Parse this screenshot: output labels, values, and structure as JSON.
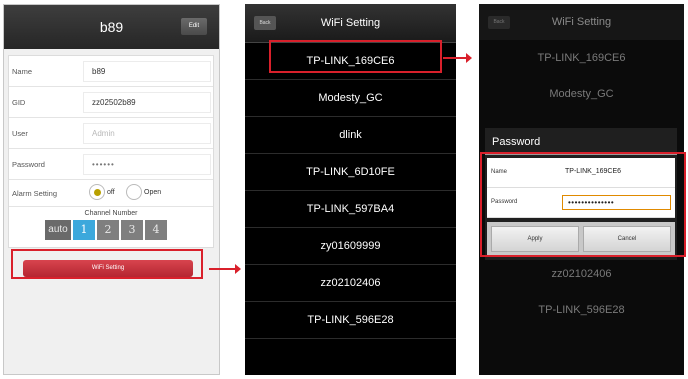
{
  "panel1": {
    "title": "b89",
    "edit_label": "Edit",
    "fields": [
      {
        "label": "Name",
        "value": "b89",
        "placeholder": false
      },
      {
        "label": "GID",
        "value": "zz02502b89",
        "placeholder": false
      },
      {
        "label": "User",
        "value": "Admin",
        "placeholder": true
      },
      {
        "label": "Password",
        "value": "••••••",
        "placeholder": false
      }
    ],
    "alarm": {
      "label": "Alarm Setting",
      "off_label": "off",
      "open_label": "Open",
      "selected": "off"
    },
    "channel": {
      "title": "Channel Number",
      "options": [
        "auto",
        "1",
        "2",
        "3",
        "4"
      ],
      "selected": "1"
    },
    "wifi_button_label": "WiFi Setting"
  },
  "panel2": {
    "back_label": "Back",
    "title": "WiFi Setting",
    "networks": [
      "TP-LINK_169CE6",
      "Modesty_GC",
      "dlink",
      "TP-LINK_6D10FE",
      "TP-LINK_597BA4",
      "zy01609999",
      "zz02102406",
      "TP-LINK_596E28"
    ]
  },
  "panel3": {
    "back_label": "Back",
    "title": "WiFi Setting",
    "networks_above": [
      "TP-LINK_169CE6",
      "Modesty_GC"
    ],
    "networks_below": [
      "zz02102406",
      "TP-LINK_596E28"
    ],
    "dialog": {
      "title": "Password",
      "name_label": "Name",
      "name_value": "TP-LINK_169CE6",
      "password_label": "Password",
      "password_value": "••••••••••••••",
      "apply_label": "Apply",
      "cancel_label": "Cancel"
    }
  },
  "colors": {
    "highlight": "#d9202b",
    "channel_selected": "#3ca8dc",
    "wifi_button": "#c6323c"
  }
}
